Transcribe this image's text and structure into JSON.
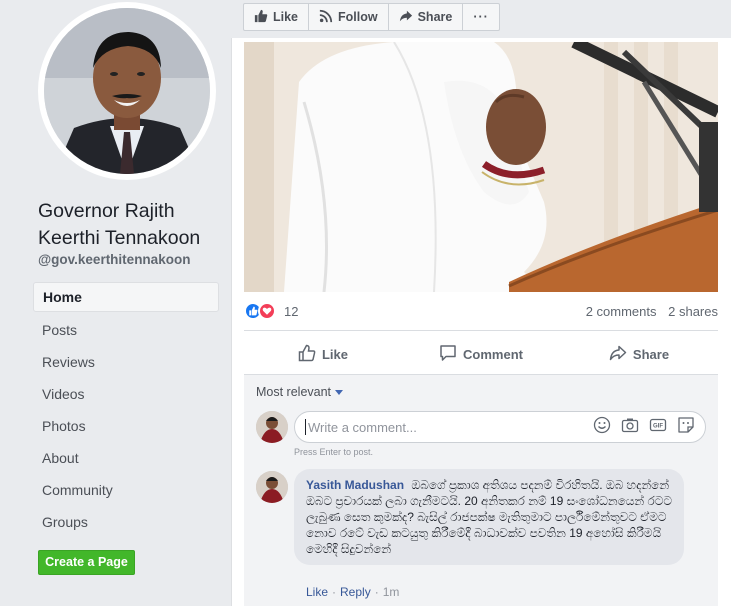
{
  "page": {
    "name": "Governor Rajith Keerthi Tennakoon",
    "handle": "@gov.keerthitennakoon"
  },
  "nav": {
    "items": [
      {
        "label": "Home",
        "active": true
      },
      {
        "label": "Posts"
      },
      {
        "label": "Reviews"
      },
      {
        "label": "Videos"
      },
      {
        "label": "Photos"
      },
      {
        "label": "About"
      },
      {
        "label": "Community"
      },
      {
        "label": "Groups"
      }
    ],
    "create_page_label": "Create a Page"
  },
  "toolbar": {
    "like_label": "Like",
    "follow_label": "Follow",
    "share_label": "Share",
    "more_label": "···"
  },
  "post": {
    "reaction_count": "12",
    "comments_label": "2 comments",
    "shares_label": "2 shares",
    "actions": {
      "like": "Like",
      "comment": "Comment",
      "share": "Share"
    }
  },
  "comments": {
    "sort_label": "Most relevant",
    "write_placeholder": "Write a comment...",
    "press_enter_hint": "Press Enter to post.",
    "items": [
      {
        "author": "Yasith Madushan",
        "text": "ඔබගේ ප්‍රකාශ අතිශය පදනම් විරහිතයි. ඔබ හදන්නේ ඔබට ප්‍රචාරයක් ලබා ගැනීමටයි. 20 අනිතකර නම් 19 සංශෝධනයෙන් රටට ලැබුණ සෙත කුමක්ද? බැසිල් රාජපක්ෂ මැතිතුමාට පාර්ලිමේන්තුවට ඒමට නොව රටේ වැඩ කටයුතු කිරීමේදී බාධාවක්ව පවතින 19 අහෝසි කිරීමයි මෙහිදී සිදුවන්නේ",
        "like": "Like",
        "reply": "Reply",
        "time": "1m"
      }
    ]
  },
  "colors": {
    "accent": "#4267b2",
    "green_button": "#42b72a",
    "love": "#f33e58",
    "like": "#1877f2"
  }
}
